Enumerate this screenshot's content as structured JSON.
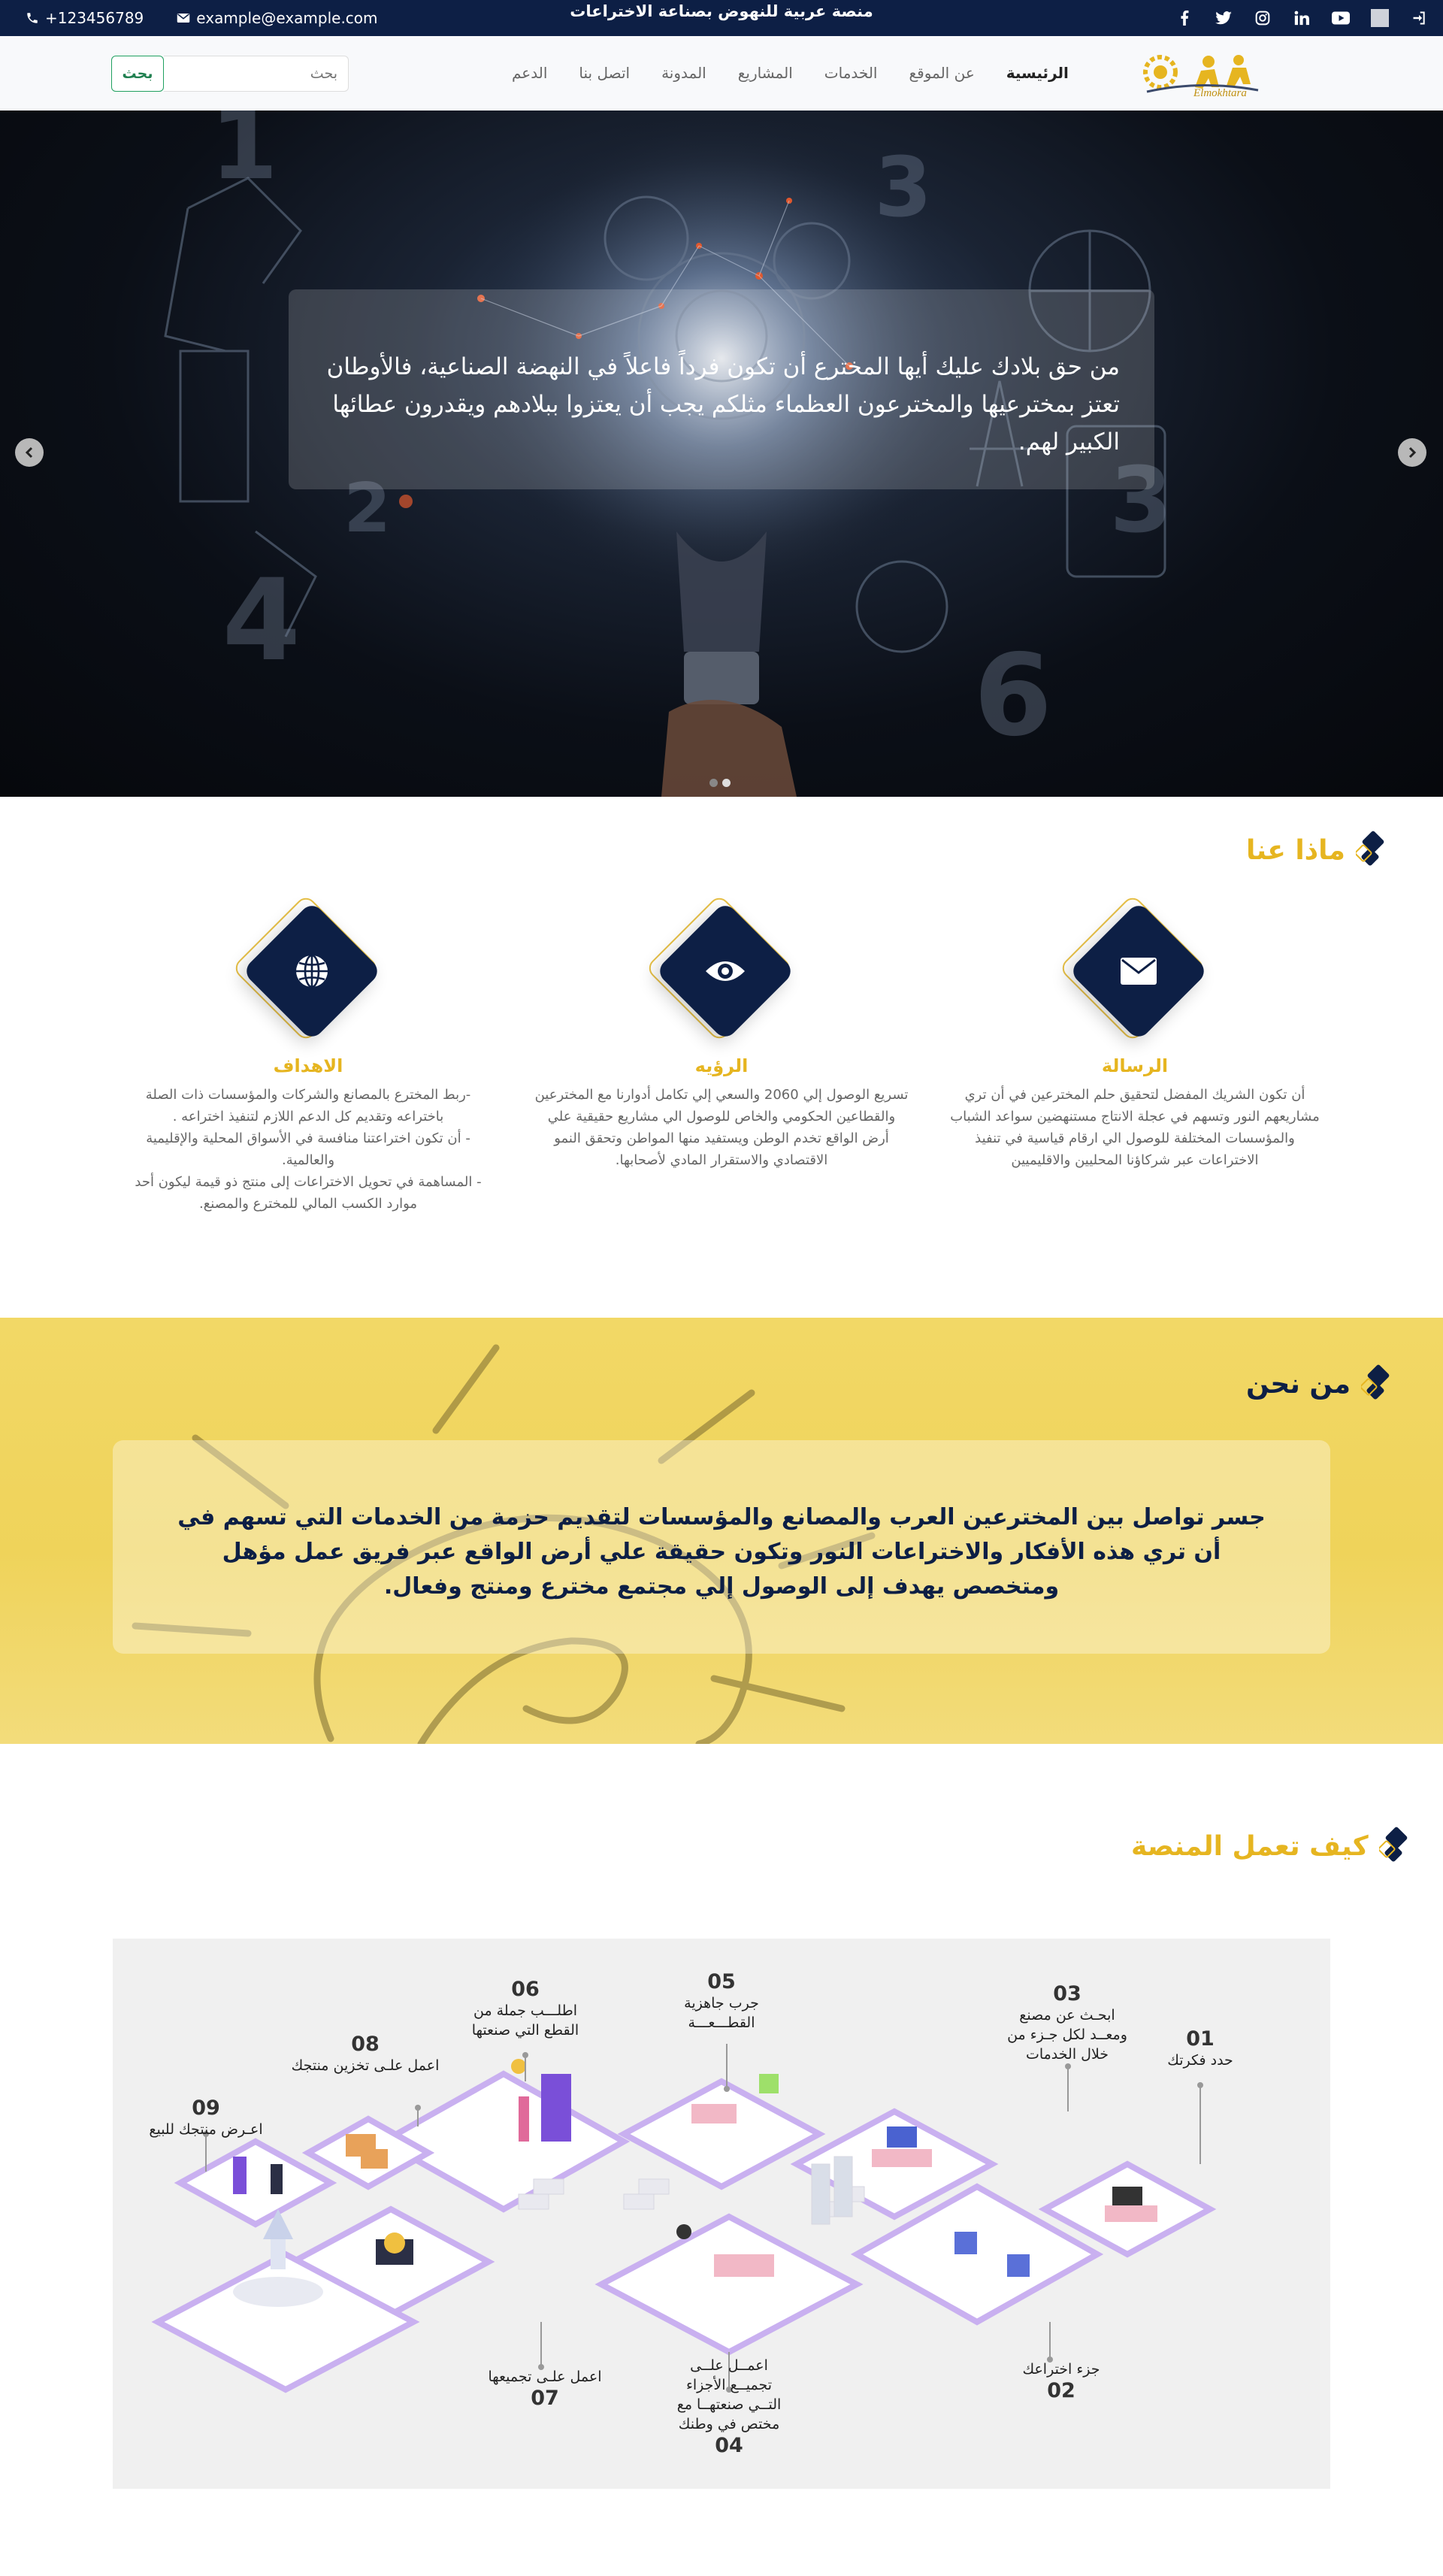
{
  "topbar": {
    "phone": "+123456789",
    "email": "example@example.com",
    "tagline": "منصة عربية للنهوض بصناعة الاختراعات",
    "socials": [
      "facebook-icon",
      "twitter-icon",
      "instagram-icon",
      "linkedin-icon",
      "youtube-icon"
    ],
    "login_icon": "sign-in-icon"
  },
  "nav": {
    "logo_text": "Elmokhtara",
    "items": [
      {
        "label": "الرئيسية",
        "active": true
      },
      {
        "label": "عن الموقع"
      },
      {
        "label": "الخدمات"
      },
      {
        "label": "المشاريع"
      },
      {
        "label": "المدونة"
      },
      {
        "label": "اتصل بنا"
      },
      {
        "label": "الدعم"
      }
    ],
    "search_placeholder": "بحث",
    "search_button": "بحث"
  },
  "hero": {
    "caption": "من حق بلادك عليك أيها المخترع أن تكون فرداً فاعلاً في النهضة الصناعية، فالأوطان تعتز بمخترعيها والمخترعون العظماء مثلكم يجب أن يعتزوا ببلادهم ويقدرون عطائها الكبير لهم.",
    "slides_count": 2,
    "active_slide": 2
  },
  "what_we_do": {
    "title": "ماذا عنا",
    "cards": [
      {
        "icon": "envelope-icon",
        "title": "الرسالة",
        "text": "أن تكون الشريك المفضل لتحقيق حلم المخترعين في أن تري مشاريعهم النور وتسهم في عجلة الانتاج مستنهضين سواعد الشباب والمؤسسات المختلفة للوصول الي ارقام قياسية في تنفيذ الاختراعات عبر شركاؤنا المحليين والاقليميين"
      },
      {
        "icon": "eye-icon",
        "title": "الرؤيه",
        "text": "تسريع الوصول إلي 2060 والسعي إلي تكامل أدوارنا مع المخترعين والقطاعين الحكومي والخاص للوصول الي مشاريع حقيقية علي أرض الواقع تخدم الوطن ويستفيد منها المواطن وتحقق النمو الاقتصادي والاستقرار المادي لأصحابها."
      },
      {
        "icon": "globe-icon",
        "title": "الاهداف",
        "lines": [
          "-ربط المخترع بالمصانع والشركات والمؤسسات ذات الصلة باختراعه وتقديم كل الدعم اللازم لتنفيذ اختراعه .",
          "- أن تكون اختراعتنا منافسة في الأسواق المحلية والإقليمية والعالمية.",
          "- المساهمة في تحويل الاختراعات إلى منتج ذو قيمة ليكون أحد موارد الكسب المالي للمخترع والمصنع."
        ]
      }
    ]
  },
  "who_we_are": {
    "title": "من نحن",
    "text": "جسر تواصل بين المخترعين العرب والمصانع والمؤسسات لتقديم حزمة من الخدمات التي تسهم في أن تري هذه الأفكار والاختراعات النور وتكون حقيقة علي أرض الواقع عبر فريق عمل مؤهل ومتخصص يهدف إلى الوصول إلي مجتمع مخترع ومنتج وفعال."
  },
  "how_it_works": {
    "title": "كيف تعمل المنصة",
    "steps": [
      {
        "num": "01",
        "label": "حدد فكرتك"
      },
      {
        "num": "02",
        "label": "جزء اختراعك"
      },
      {
        "num": "03",
        "label": "ابحـث عن مصنع ومعــد لكل جـزء من خلال الخدمات"
      },
      {
        "num": "04",
        "label": "اعمــل علــى تجميــع الأجزاء التــي صنعتهــا مع مختص في وطنك"
      },
      {
        "num": "05",
        "label": "جرب جاهزية القطـــعـــة"
      },
      {
        "num": "06",
        "label": "اطلـــب جملة من القطع التي صنعتها"
      },
      {
        "num": "07",
        "label": "اعمل علـى تجميعها"
      },
      {
        "num": "08",
        "label": "اعمل علـى تخزين منتجك"
      },
      {
        "num": "09",
        "label": "اعـرض منتجك للبيع"
      }
    ]
  },
  "colors": {
    "navy": "#0d1f45",
    "gold": "#e6b520",
    "yellow_bg": "#efd35a"
  }
}
